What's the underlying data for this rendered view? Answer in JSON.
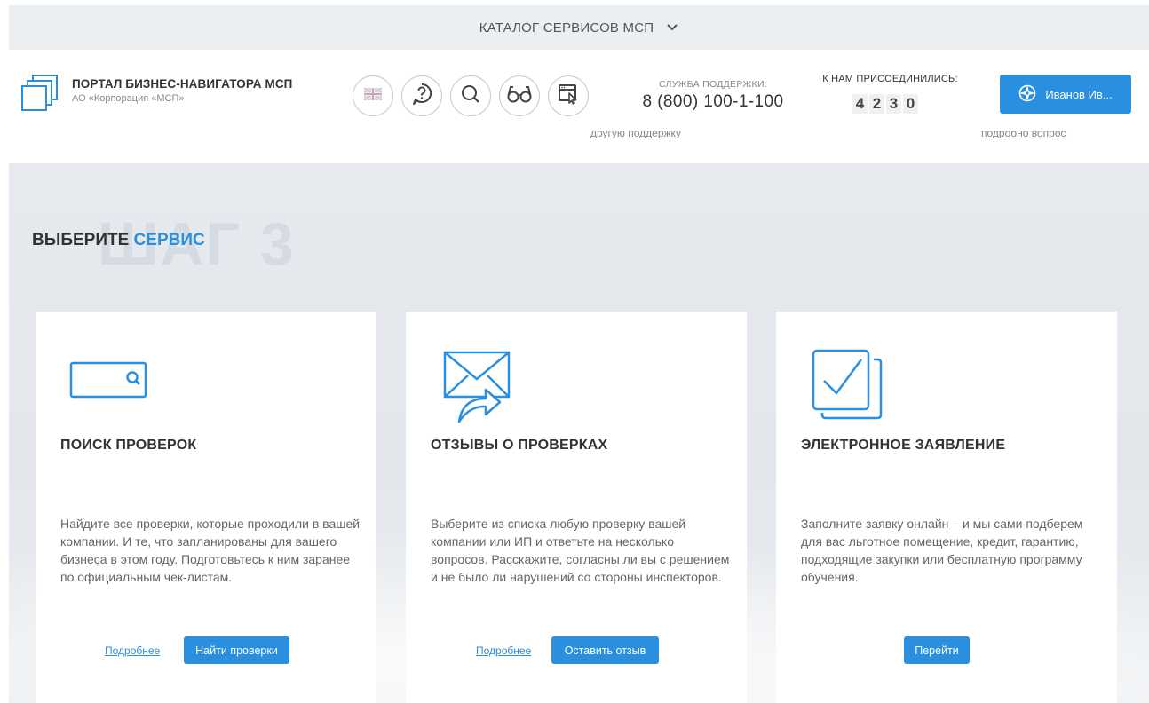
{
  "catalog": {
    "label": "КАТАЛОГ СЕРВИСОВ МСП",
    "icon": "chevron-down-icon"
  },
  "brand": {
    "title": "ПОРТАЛ БИЗНЕС-НАВИГАТОРА МСП",
    "subtitle": "АО «Корпорация «МСП»",
    "icon": "stacked-squares-logo-icon"
  },
  "toolbar_icons": [
    "uk-flag-icon",
    "help-question-icon",
    "search-icon",
    "glasses-icon",
    "browser-cursor-icon"
  ],
  "support": {
    "label": "СЛУЖБА ПОДДЕРЖКИ:",
    "phone": "8 (800) 100-1-100",
    "ghost": "другую поддержку"
  },
  "joined": {
    "label": "К НАМ ПРИСОЕДИНИЛИСЬ:",
    "digits": [
      "4",
      "2",
      "3",
      "0"
    ],
    "ghost": "подробно вопрос"
  },
  "user": {
    "name": "Иванов Ив...",
    "icon": "compass-icon"
  },
  "step_bg": "ШАГ 3",
  "section": {
    "prefix": "ВЫБЕРИТЕ",
    "accent": "СЕРВИС"
  },
  "colors": {
    "accent": "#2b8fe0",
    "catalog_bg": "#eceff2",
    "main_bg": "#e5e9ed"
  },
  "cards": [
    {
      "icon": "search-box-icon",
      "title": "ПОИСК ПРОВЕРОК",
      "text": "Найдите все проверки, которые проходили в вашей компании. И те, что запланированы для вашего бизнеса в этом году. Подготовьтесь к ним заранее по официальным чек-листам.",
      "link": "Подробнее",
      "button": "Найти проверки"
    },
    {
      "icon": "envelope-send-icon",
      "title": "ОТЗЫВЫ О ПРОВЕРКАХ",
      "text": "Выберите из списка любую проверку вашей компании или ИП и ответьте на несколько вопросов. Расскажите, согласны ли вы с решением и не было ли нарушений со стороны инспекторов.",
      "link": "Подробнее",
      "button": "Оставить отзыв"
    },
    {
      "icon": "checkbox-document-icon",
      "title": "ЭЛЕКТРОННОЕ ЗАЯВЛЕНИЕ",
      "text": "Заполните заявку онлайн – и мы сами подберем для вас льготное помещение, кредит, гарантию, подходящие закупки или бесплатную программу обучения.",
      "button": "Перейти"
    }
  ]
}
